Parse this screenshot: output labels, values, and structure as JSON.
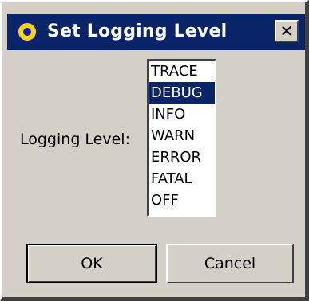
{
  "window": {
    "title": "Set Logging Level",
    "close_glyph": "✕",
    "icon": "app-logo-icon"
  },
  "form": {
    "label": "Logging Level:",
    "levels": [
      "TRACE",
      "DEBUG",
      "INFO",
      "WARN",
      "ERROR",
      "FATAL",
      "OFF"
    ],
    "selected": "DEBUG"
  },
  "buttons": {
    "ok_label": "OK",
    "cancel_label": "Cancel"
  },
  "colors": {
    "titlebar": "#0a246a",
    "selection": "#0a246a",
    "dialog_face": "#d4d0c8"
  }
}
